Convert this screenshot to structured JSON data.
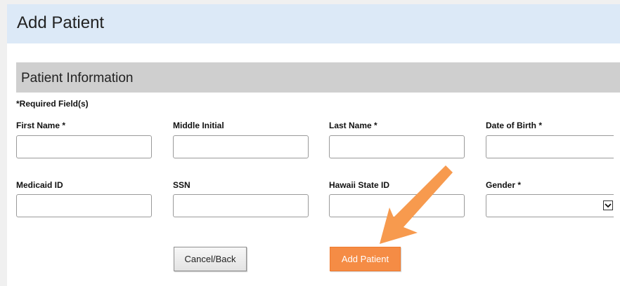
{
  "page": {
    "title": "Add Patient"
  },
  "section": {
    "title": "Patient Information",
    "required_note": "*Required Field(s)"
  },
  "fields": {
    "first_name": {
      "label": "First Name *",
      "value": ""
    },
    "middle_initial": {
      "label": "Middle Initial",
      "value": ""
    },
    "last_name": {
      "label": "Last Name *",
      "value": ""
    },
    "date_of_birth": {
      "label": "Date of Birth *",
      "value": ""
    },
    "medicaid_id": {
      "label": "Medicaid ID",
      "value": ""
    },
    "ssn": {
      "label": "SSN",
      "value": ""
    },
    "hawaii_state_id": {
      "label": "Hawaii State ID",
      "value": ""
    },
    "gender": {
      "label": "Gender *",
      "selected": ""
    }
  },
  "buttons": {
    "cancel_label": "Cancel/Back",
    "add_label": "Add Patient"
  },
  "colors": {
    "header_background": "#dce9f7",
    "section_background": "#cfcfcf",
    "add_button": "#f58c45",
    "annotation_arrow": "#f79a4e"
  },
  "icons": {
    "select_arrow": "chevron-down-icon",
    "annotation": "pointer-arrow-icon"
  }
}
